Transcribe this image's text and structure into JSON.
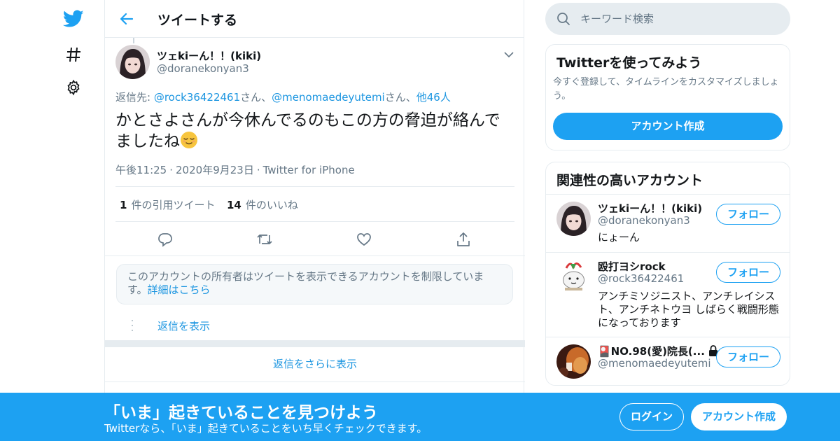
{
  "nav": {
    "logo": "twitter-bird-icon",
    "explore": "hashtag-icon",
    "settings": "gear-icon"
  },
  "header": {
    "back": "back-arrow-icon",
    "title": "ツイートする"
  },
  "tweet": {
    "author_name": "ツェkiーん！！(kiki)",
    "author_handle": "@doranekonyan3",
    "reply_prefix": "返信先: ",
    "reply_user1": "@rock36422461",
    "reply_san1": "さん、",
    "reply_user2": "@menomaedeyutemi",
    "reply_san2": "さん、",
    "reply_others": "他46人",
    "text": "かとさよさんが今休んでるのもこの方の脅迫が絡んでましたね",
    "time": "午後11:25",
    "date": "2020年9月23日",
    "source": "Twitter for iPhone",
    "quote_count": "1",
    "quote_label": "件の引用ツイート",
    "like_count": "14",
    "like_label": "件のいいね"
  },
  "notice": {
    "text": "このアカウントの所有者はツイートを表示できるアカウントを制限しています。",
    "link": "詳細はこちら"
  },
  "replies": {
    "show": "返信を表示",
    "more": "返信をさらに表示"
  },
  "search": {
    "placeholder": "キーワード検索"
  },
  "try_card": {
    "title": "Twitterを使ってみよう",
    "desc": "今すぐ登録して、タイムラインをカスタマイズしましょう。",
    "button": "アカウント作成"
  },
  "related": {
    "title": "関連性の高いアカウント",
    "follow": "フォロー",
    "accounts": [
      {
        "name": "ツェkiーん！！(kiki)",
        "handle": "@doranekonyan3",
        "bio": "にょーん"
      },
      {
        "name": "殴打ヨシrock",
        "handle": "@rock36422461",
        "bio": "アンチミソジニスト、アンチレイシスト、アンチネトウヨ しばらく戦闘形態になっております"
      },
      {
        "name": "🎴NO.98(愛)院長(...",
        "handle": "@menomaedeyutemi",
        "bio": ""
      }
    ]
  },
  "bottom": {
    "title": "「いま」起きていることを見つけよう",
    "sub": "Twitterなら、「いま」起きていることをいち早くチェックできます。",
    "login": "ログイン",
    "signup": "アカウント作成"
  },
  "colors": {
    "brand": "#1da1f2",
    "link": "#1b95e0"
  }
}
